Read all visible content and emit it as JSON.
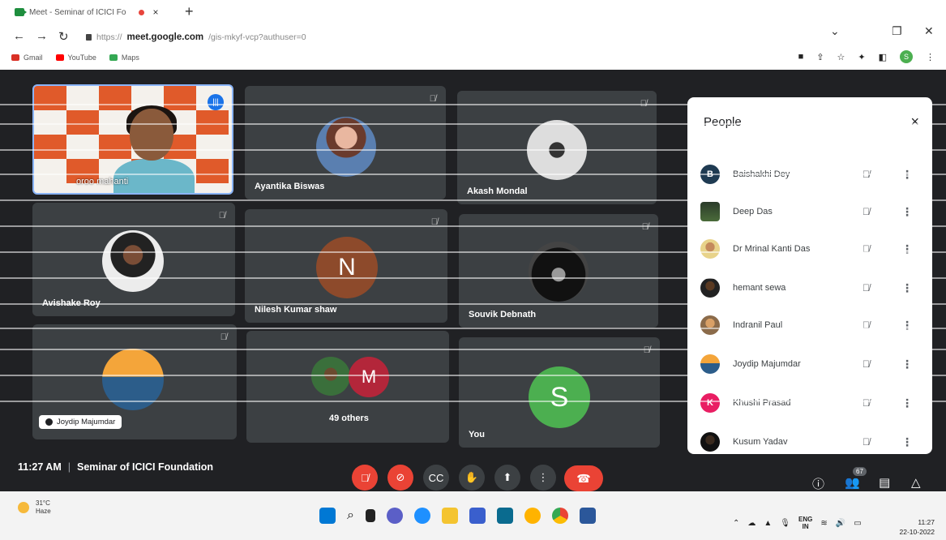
{
  "browser": {
    "tab_title": "Meet - Seminar of ICICI Fo",
    "tab_close": "×",
    "new_tab": "+",
    "url_prefix": "https://",
    "url_domain": "meet.google.com",
    "url_path": "/gis-mkyf-vcp?authuser=0",
    "bookmarks": [
      "Gmail",
      "YouTube",
      "Maps"
    ],
    "profile_initial": "S"
  },
  "tiles": {
    "speaker_name": "oroo mahanti",
    "t2_name": "Ayantika Biswas",
    "t3_name": "Akash Mondal",
    "t4_name": "Avishake Roy",
    "t5_name": "Nilesh Kumar shaw",
    "t5_initial": "N",
    "t6_name": "Souvik Debnath",
    "t7_chip": "Joydip Majumdar",
    "t8_label": "49 others",
    "t8_initial": "M",
    "t9_name": "You",
    "t9_initial": "S"
  },
  "people_panel": {
    "title": "People",
    "close": "×",
    "participants": [
      {
        "name": "Baishakhi Dey",
        "initial": "B"
      },
      {
        "name": "Deep Das",
        "initial": ""
      },
      {
        "name": "Dr Mrinal Kanti Das",
        "initial": ""
      },
      {
        "name": "hemant sewa",
        "initial": ""
      },
      {
        "name": "Indranil Paul",
        "initial": ""
      },
      {
        "name": "Joydip Majumdar",
        "initial": ""
      },
      {
        "name": "Khushi Prasad",
        "initial": "K"
      },
      {
        "name": "Kusum Yadav",
        "initial": ""
      }
    ]
  },
  "meeting": {
    "time": "11:27 AM",
    "separator": "|",
    "title": "Seminar of ICICI Foundation",
    "participant_count": "67"
  },
  "taskbar": {
    "temperature": "31°C",
    "condition": "Haze",
    "lang_top": "ENG",
    "lang_bottom": "IN",
    "time": "11:27",
    "date": "22-10-2022"
  },
  "colors": {
    "meet_bg": "#202124",
    "tile_bg": "#3c4043",
    "red": "#ea4335",
    "blue": "#1a73e8",
    "green_avatar": "#4caf50",
    "brown_avatar": "#8d4a2b",
    "maroon_avatar": "#b3263a",
    "pink_avatar": "#e91e63"
  },
  "icons": [
    "mic-off-icon",
    "camera-off-icon",
    "captions-icon",
    "raise-hand-icon",
    "present-icon",
    "more-vert-icon",
    "hang-up-icon",
    "info-icon",
    "people-icon",
    "chat-icon",
    "activities-icon"
  ]
}
